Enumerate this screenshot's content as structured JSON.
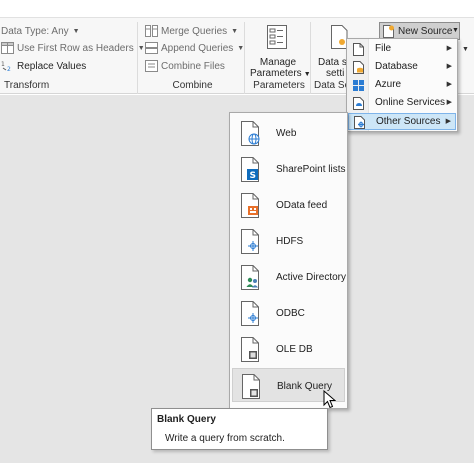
{
  "ribbon": {
    "transform": {
      "data_type": "Data Type: Any",
      "use_first_row": "Use First Row as Headers",
      "replace_values": "Replace Values",
      "group_label": "Transform"
    },
    "combine": {
      "merge_queries": "Merge Queries",
      "append_queries": "Append Queries",
      "combine_files": "Combine Files",
      "group_label": "Combine"
    },
    "parameters": {
      "manage_line1": "Manage",
      "manage_line2": "Parameters",
      "group_label": "Parameters"
    },
    "data_source": {
      "line1": "Data so",
      "line2": "setti",
      "group_label": "Data So"
    },
    "new_source_button": "New Source"
  },
  "new_source_menu": {
    "items": [
      {
        "label": "File",
        "icon": "file-icon"
      },
      {
        "label": "Database",
        "icon": "database-icon"
      },
      {
        "label": "Azure",
        "icon": "azure-icon"
      },
      {
        "label": "Online Services",
        "icon": "online-services-icon"
      },
      {
        "label": "Other Sources",
        "icon": "other-sources-icon"
      }
    ]
  },
  "other_sources_menu": {
    "items": [
      {
        "label": "Web",
        "icon": "web-icon"
      },
      {
        "label": "SharePoint lists",
        "icon": "sharepoint-icon"
      },
      {
        "label": "OData feed",
        "icon": "odata-icon"
      },
      {
        "label": "HDFS",
        "icon": "hdfs-icon"
      },
      {
        "label": "Active Directory",
        "icon": "active-directory-icon"
      },
      {
        "label": "ODBC",
        "icon": "odbc-icon"
      },
      {
        "label": "OLE DB",
        "icon": "ole-db-icon"
      },
      {
        "label": "Blank Query",
        "icon": "blank-query-icon"
      }
    ]
  },
  "tooltip": {
    "title": "Blank Query",
    "description": "Write a query from scratch."
  },
  "colors": {
    "accent_blue": "#2b7cd3",
    "menu_hover": "#cde6f7",
    "workspace": "#e5e5e5"
  }
}
